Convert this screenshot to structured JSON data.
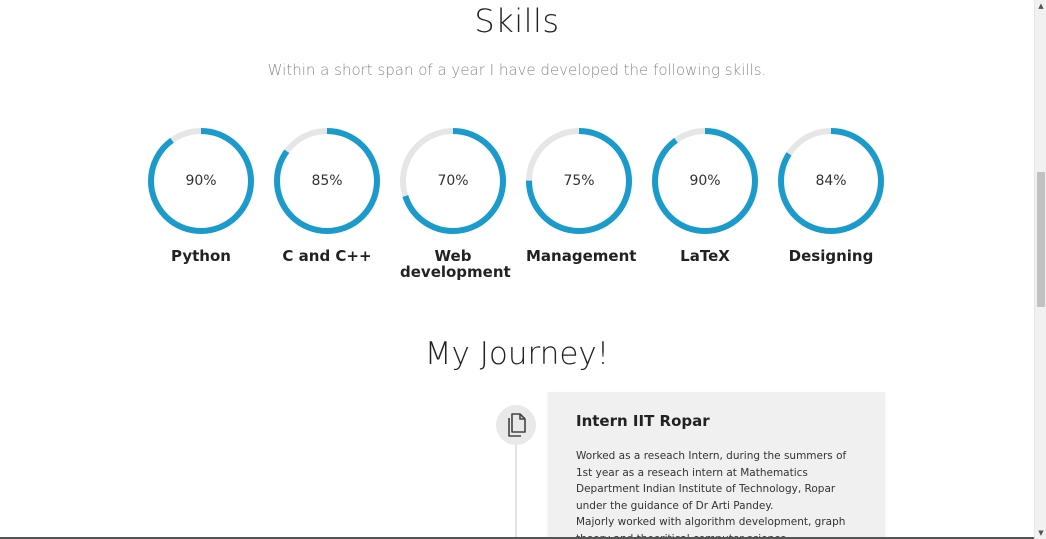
{
  "skills": {
    "title": "Skills",
    "subtitle": "Within a short span of a year I have developed the following skills.",
    "accent_color": "#1a9bcc",
    "track_color": "#e6e6e6",
    "items": [
      {
        "label": "Python",
        "value_text": "90%",
        "percent": 90
      },
      {
        "label": "C and C++",
        "value_text": "85%",
        "percent": 85
      },
      {
        "label": "Web development",
        "value_text": "70%",
        "percent": 70
      },
      {
        "label": "Management",
        "value_text": "75%",
        "percent": 75
      },
      {
        "label": "LaTeX",
        "value_text": "90%",
        "percent": 90
      },
      {
        "label": "Designing",
        "value_text": "84%",
        "percent": 84
      }
    ]
  },
  "journey": {
    "title": "My Journey!",
    "entries": [
      {
        "icon": "document-icon",
        "title": "Intern IIT Ropar",
        "body": "Worked as a reseach Intern, during the summers of 1st year as a reseach intern at Mathematics Department Indian Institute of Technology, Ropar under the guidance of Dr Arti Pandey.\nMajorly worked with algorithm development, graph theory and theoritical computer science."
      }
    ]
  },
  "scrollbar": {
    "up_glyph": "▲",
    "down_glyph": "▼"
  }
}
